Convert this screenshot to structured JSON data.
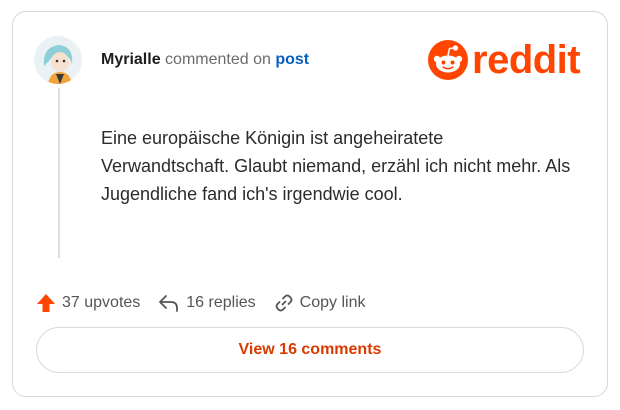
{
  "header": {
    "author": "Myrialle",
    "commented_on": "commented on",
    "post_link": "post"
  },
  "logo": {
    "text": "reddit",
    "color": "#ff4500"
  },
  "comment": {
    "body": "Eine europäische Königin ist angeheiratete Verwandtschaft. Glaubt niemand, erzähl ich nicht mehr. Als Jugendliche fand ich's irgendwie cool."
  },
  "actions": {
    "upvotes": "37 upvotes",
    "replies": "16 replies",
    "copy_link": "Copy link"
  },
  "view_comments": "View 16 comments",
  "colors": {
    "accent": "#ff4500",
    "view_comments": "#d93a00",
    "link": "#0a5fbf"
  }
}
